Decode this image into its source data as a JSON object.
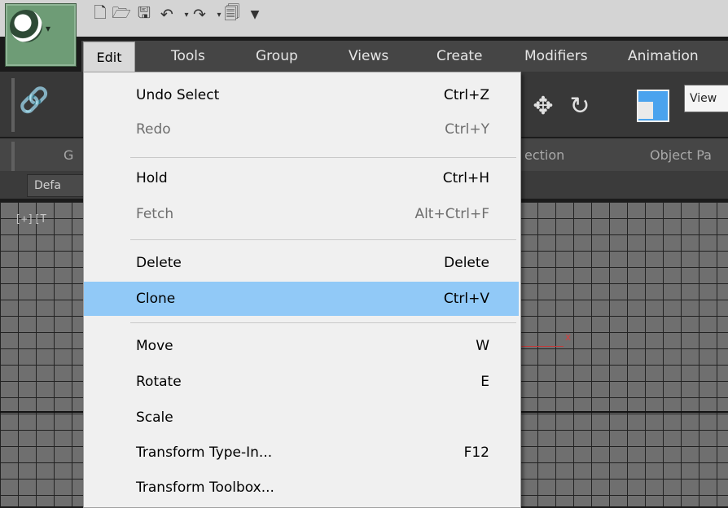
{
  "quick_access": {
    "icons": [
      "new-file-icon",
      "open-folder-icon",
      "save-icon",
      "undo-icon",
      "dropdown-arrow-icon",
      "redo-icon",
      "dropdown-arrow-icon",
      "project-folder-icon",
      "customize-dropdown-icon"
    ]
  },
  "menubar": {
    "items": [
      "Edit",
      "Tools",
      "Group",
      "Views",
      "Create",
      "Modifiers",
      "Animation"
    ]
  },
  "toolbar": {
    "view_dropdown": "View"
  },
  "ribbon": {
    "tab_g": "G",
    "tab_selection": "ection",
    "tab_object_paint": "Object Pa"
  },
  "layer": {
    "dropdown": "Defa"
  },
  "viewport": {
    "label": "[+][T",
    "axis_label": "x"
  },
  "edit_menu": {
    "items": [
      {
        "label": "Undo Select",
        "shortcut": "Ctrl+Z",
        "enabled": true
      },
      {
        "label": "Redo",
        "shortcut": "Ctrl+Y",
        "enabled": false
      },
      {
        "label": "Hold",
        "shortcut": "Ctrl+H",
        "enabled": true
      },
      {
        "label": "Fetch",
        "shortcut": "Alt+Ctrl+F",
        "enabled": false
      },
      {
        "label": "Delete",
        "shortcut": "Delete",
        "enabled": true
      },
      {
        "label": "Clone",
        "shortcut": "Ctrl+V",
        "enabled": true,
        "selected": true
      },
      {
        "label": "Move",
        "shortcut": "W",
        "enabled": true
      },
      {
        "label": "Rotate",
        "shortcut": "E",
        "enabled": true
      },
      {
        "label": "Scale",
        "shortcut": "",
        "enabled": true
      },
      {
        "label": "Transform Type-In...",
        "shortcut": "F12",
        "enabled": true
      },
      {
        "label": "Transform Toolbox...",
        "shortcut": "",
        "enabled": true
      }
    ]
  },
  "colors": {
    "selection_highlight": "#91c9f7",
    "app_button": "#6e9c76",
    "axis_x": "#c23b3b"
  }
}
